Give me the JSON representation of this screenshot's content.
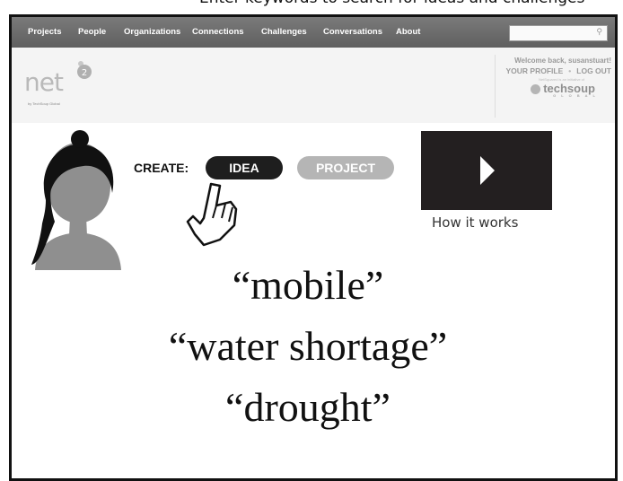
{
  "top_caption": "Enter keywords to search for ideas and challenges",
  "navbar": {
    "items": [
      "Projects",
      "People",
      "Organizations",
      "Connections",
      "Challenges",
      "Conversations",
      "About"
    ],
    "search": {
      "placeholder": "",
      "icon": "search-icon"
    }
  },
  "header": {
    "logo": {
      "text": "net",
      "badge": "2",
      "tagline": "by TechSoup Global"
    },
    "account": {
      "welcome": "Welcome back, susanstuart!",
      "profile": "YOUR PROFILE",
      "separator": "•",
      "logout": "LOG OUT",
      "initiative": "NetSquared is an initiative of",
      "partner": "techsoup",
      "partner_sub": "GLOBAL"
    }
  },
  "create": {
    "label": "CREATE:",
    "idea": "IDEA",
    "project": "PROJECT"
  },
  "video": {
    "caption": "How it works"
  },
  "keywords": [
    "“mobile”",
    "“water shortage”",
    "“drought”"
  ],
  "colors": {
    "navbar": "#6e6e6e",
    "idea_button": "#1e1e1e",
    "project_button": "#b5b5b5",
    "video": "#231f20"
  }
}
